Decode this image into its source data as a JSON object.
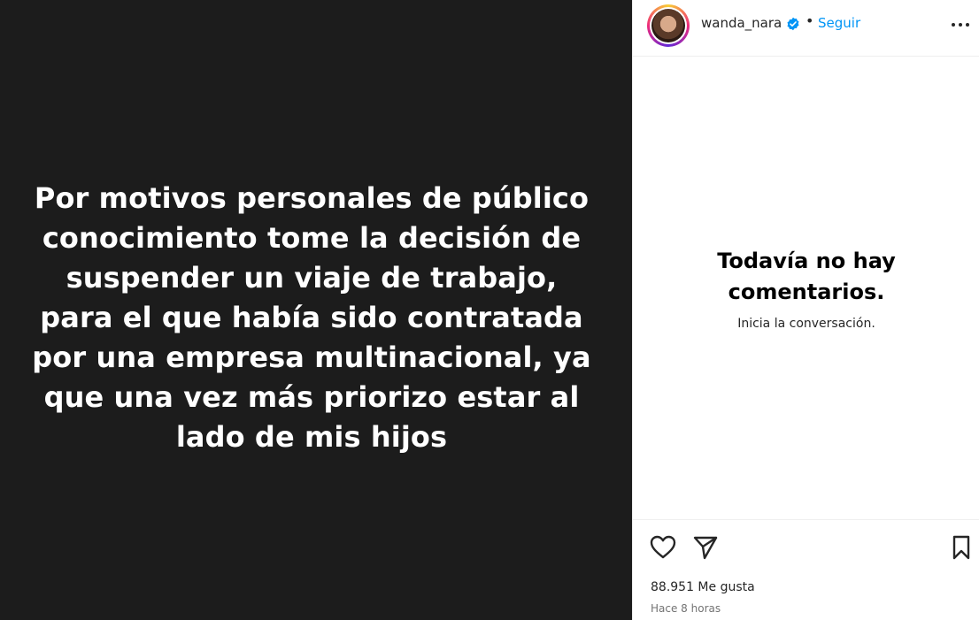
{
  "post": {
    "text": "Por motivos personales de público\nconocimiento tome la decisión de\nsuspender un viaje de trabajo,\npara el que había sido contratada\npor una empresa multinacional, ya\nque una vez más priorizo estar al\nlado de mis hijos",
    "background_color": "#1c1c1c"
  },
  "header": {
    "username": "wanda_nara",
    "separator": "•",
    "follow_label": "Seguir",
    "verified_icon": "verified-badge-icon",
    "more_icon": "more-options-icon"
  },
  "comments": {
    "empty_title": "Todavía no hay\ncomentarios.",
    "empty_subtitle": "Inicia la conversación."
  },
  "actions": {
    "like_icon": "heart-icon",
    "share_icon": "paper-plane-icon",
    "save_icon": "bookmark-icon",
    "likes_text": "88.951 Me gusta",
    "time_text": "Hace 8 horas"
  },
  "colors": {
    "accent": "#0095f6",
    "verified": "#0095f6"
  }
}
